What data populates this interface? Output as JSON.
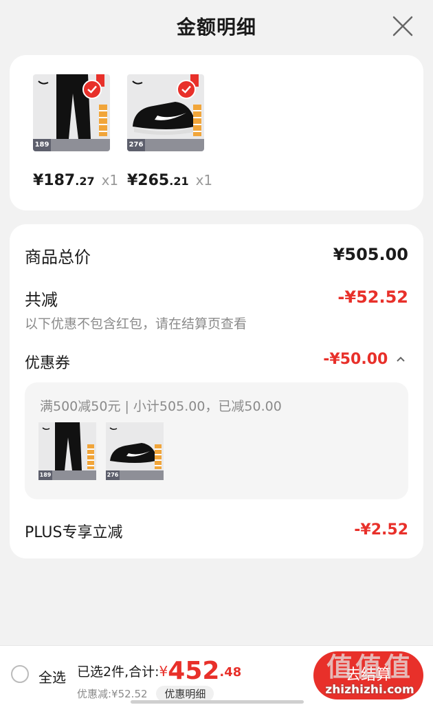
{
  "header": {
    "title": "金额明细"
  },
  "products": [
    {
      "price_int": "¥187",
      "price_dec": ".27",
      "qty": "x1",
      "tag": "189"
    },
    {
      "price_int": "¥265",
      "price_dec": ".21",
      "qty": "x1",
      "tag": "276"
    }
  ],
  "summary": {
    "total_label": "商品总价",
    "total_value": "¥505.00",
    "reduce_label": "共减",
    "reduce_value": "-¥52.52",
    "note": "以下优惠不包含红包，请在结算页查看",
    "coupon_label": "优惠券",
    "coupon_value": "-¥50.00",
    "coupon_detail": "满500减50元 | 小计505.00，已减50.00",
    "plus_label": "PLUS专享立减",
    "plus_value": "-¥2.52"
  },
  "bottom": {
    "select_all": "全选",
    "selected_text": "已选2件,合计:",
    "currency": "¥",
    "total_int": "452",
    "total_dec": ".48",
    "discount_text": "优惠减:¥52.52",
    "detail_button": "优惠明细",
    "checkout_label": "去结算"
  },
  "watermark": {
    "main": "值值值",
    "url": "zhizhizhi.com"
  },
  "colors": {
    "accent": "#e8302a"
  }
}
